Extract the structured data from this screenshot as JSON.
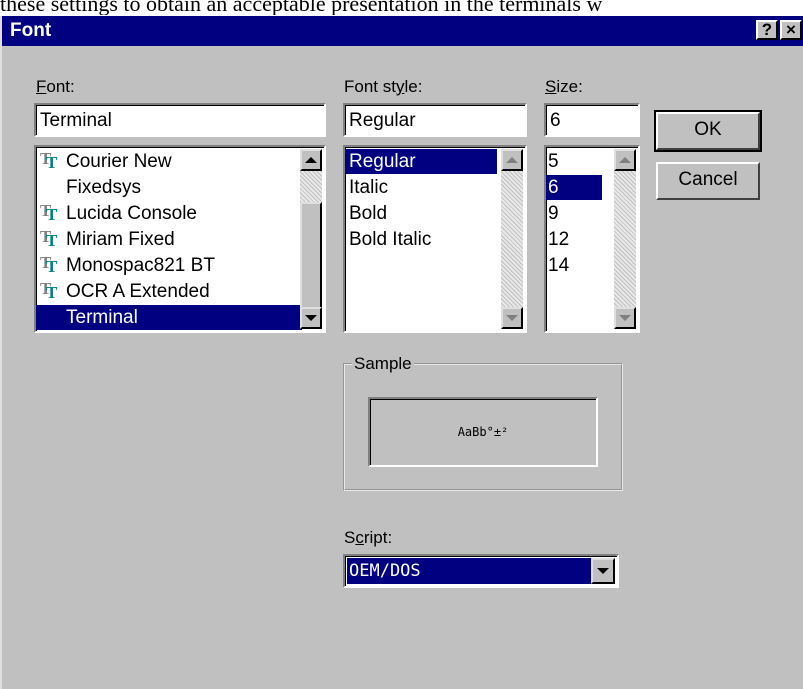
{
  "background_text": "these settings to obtain an acceptable presentation in the terminals w",
  "dialog": {
    "title": "Font",
    "help_button": "?",
    "close_button": "×"
  },
  "font": {
    "label": "Font:",
    "value": "Terminal",
    "items": [
      {
        "label": "Courier New",
        "truetype": true
      },
      {
        "label": "Fixedsys",
        "truetype": false
      },
      {
        "label": "Lucida Console",
        "truetype": true
      },
      {
        "label": "Miriam Fixed",
        "truetype": true
      },
      {
        "label": "Monospac821 BT",
        "truetype": true
      },
      {
        "label": "OCR A Extended",
        "truetype": true
      },
      {
        "label": "Terminal",
        "truetype": false
      }
    ],
    "selected": "Terminal"
  },
  "style": {
    "label": "Font style:",
    "value": "Regular",
    "items": [
      "Regular",
      "Italic",
      "Bold",
      "Bold Italic"
    ],
    "selected": "Regular"
  },
  "size": {
    "label": "Size:",
    "value": "6",
    "items": [
      "5",
      "6",
      "9",
      "12",
      "14"
    ],
    "selected": "6"
  },
  "buttons": {
    "ok": "OK",
    "cancel": "Cancel"
  },
  "sample": {
    "label": "Sample",
    "text": "AaBb°±²"
  },
  "script": {
    "label": "Script:",
    "value": "OEM/DOS"
  },
  "icons": {
    "truetype": "truetype-font-icon",
    "scroll_up": "scroll-up-arrow-icon",
    "scroll_down": "scroll-down-arrow-icon",
    "dropdown": "dropdown-arrow-icon"
  },
  "colors": {
    "title_bar": "#000080",
    "selection": "#000080",
    "face": "#c0c0c0",
    "truetype_icon": "#008080"
  }
}
